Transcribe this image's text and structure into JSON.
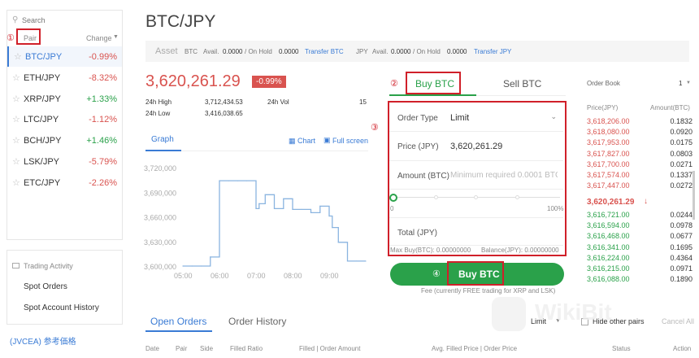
{
  "page_title": "BTC/JPY",
  "sidebar": {
    "search_placeholder": "Search",
    "col_pair": "Pair",
    "col_change": "Change",
    "pairs": [
      {
        "pair": "BTC/JPY",
        "change": "-0.99%",
        "dir": "down"
      },
      {
        "pair": "ETH/JPY",
        "change": "-8.32%",
        "dir": "down"
      },
      {
        "pair": "XRP/JPY",
        "change": "+1.33%",
        "dir": "up"
      },
      {
        "pair": "LTC/JPY",
        "change": "-1.12%",
        "dir": "down"
      },
      {
        "pair": "BCH/JPY",
        "change": "+1.46%",
        "dir": "up"
      },
      {
        "pair": "LSK/JPY",
        "change": "-5.79%",
        "dir": "down"
      },
      {
        "pair": "ETC/JPY",
        "change": "-2.26%",
        "dir": "down"
      }
    ],
    "trading_activity": "Trading Activity",
    "spot_orders": "Spot Orders",
    "spot_history": "Spot Account History",
    "jvcea": "(JVCEA) 参考価格"
  },
  "asset": {
    "label": "Asset",
    "btc": "BTC",
    "avail": "Avail.",
    "btc_avail": "0.0000",
    "on_hold": "/ On Hold",
    "btc_hold": "0.0000",
    "transfer_btc": "Transfer BTC",
    "jpy": "JPY",
    "jpy_avail": "0.0000",
    "jpy_hold": "0.0000",
    "transfer_jpy": "Transfer JPY"
  },
  "ticker": {
    "price": "3,620,261.29",
    "change": "-0.99%",
    "high_label": "24h High",
    "high": "3,712,434.53",
    "vol_label": "24h Vol",
    "vol": "15",
    "low_label": "24h Low",
    "low": "3,416,038.65"
  },
  "graph": {
    "tab": "Graph",
    "chart_link": "Chart",
    "fullscreen": "Full screen"
  },
  "chart_data": {
    "type": "line",
    "x": [
      "05:00",
      "05:15",
      "05:30",
      "05:45",
      "06:00",
      "06:15",
      "06:30",
      "06:45",
      "07:00",
      "07:05",
      "07:15",
      "07:30",
      "07:45",
      "08:00",
      "08:15",
      "08:30",
      "08:45",
      "09:00",
      "09:05",
      "09:15",
      "09:30",
      "09:45",
      "10:00"
    ],
    "values": [
      3601000,
      3601000,
      3601000,
      3612000,
      3705000,
      3705000,
      3705000,
      3705000,
      3671000,
      3677000,
      3688000,
      3671000,
      3683000,
      3670000,
      3670000,
      3666000,
      3674000,
      3662000,
      3648000,
      3630000,
      3607000,
      3607000,
      3607000
    ],
    "x_ticks": [
      "05:00",
      "06:00",
      "07:00",
      "08:00",
      "09:00"
    ],
    "y_ticks": [
      "3,720,000",
      "3,690,000",
      "3,660,000",
      "3,630,000",
      "3,600,000"
    ],
    "ylim": [
      3600000,
      3720000
    ],
    "line_color": "#8ab4e0"
  },
  "trade": {
    "buy_tab": "Buy BTC",
    "sell_tab": "Sell BTC",
    "order_type_label": "Order Type",
    "order_type": "Limit",
    "price_label": "Price (JPY)",
    "price": "3,620,261.29",
    "amount_label": "Amount (BTC)",
    "amount_placeholder": "Minimum required 0.0001 BTC",
    "slider_min": "0",
    "slider_max": "100%",
    "total_label": "Total (JPY)",
    "max_buy": "Max Buy(BTC): 0.00000000",
    "balance": "Balance(JPY): 0.00000000",
    "buy_button": "Buy BTC",
    "fee_note": "Fee (currently FREE trading for XRP and LSK)",
    "slider_value": 0
  },
  "annotations": {
    "n1": "①",
    "n2": "②",
    "n3": "③",
    "n4": "④"
  },
  "orderbook": {
    "title": "Order Book",
    "depth": "1",
    "col_price": "Price(JPY)",
    "col_amount": "Amount(BTC)",
    "asks": [
      [
        "3,618,206.00",
        "0.1832"
      ],
      [
        "3,618,080.00",
        "0.0920"
      ],
      [
        "3,617,953.00",
        "0.0175"
      ],
      [
        "3,617,827.00",
        "0.0803"
      ],
      [
        "3,617,700.00",
        "0.0271"
      ],
      [
        "3,617,574.00",
        "0.1337"
      ],
      [
        "3,617,447.00",
        "0.0272"
      ]
    ],
    "last": "3,620,261.29",
    "bids": [
      [
        "3,616,721.00",
        "0.0244"
      ],
      [
        "3,616,594.00",
        "0.0978"
      ],
      [
        "3,616,468.00",
        "0.0677"
      ],
      [
        "3,616,341.00",
        "0.1695"
      ],
      [
        "3,616,224.00",
        "0.4364"
      ],
      [
        "3,616,215.00",
        "0.0971"
      ],
      [
        "3,616,088.00",
        "0.1890"
      ]
    ]
  },
  "orders": {
    "open_tab": "Open Orders",
    "history_tab": "Order History",
    "filter": "Limit",
    "hide_pairs": "Hide other pairs",
    "cancel_all": "Cancel All",
    "cols": [
      "Date",
      "Pair",
      "Side",
      "Filled Ratio",
      "Filled | Order Amount",
      "Avg. Filled Price | Order Price",
      "Status",
      "Action"
    ]
  },
  "watermark": "WikiBit",
  "colors": {
    "green": "#2aa14a",
    "red": "#d9534f",
    "blue": "#3a7bd5",
    "annotation": "#d0202a"
  }
}
